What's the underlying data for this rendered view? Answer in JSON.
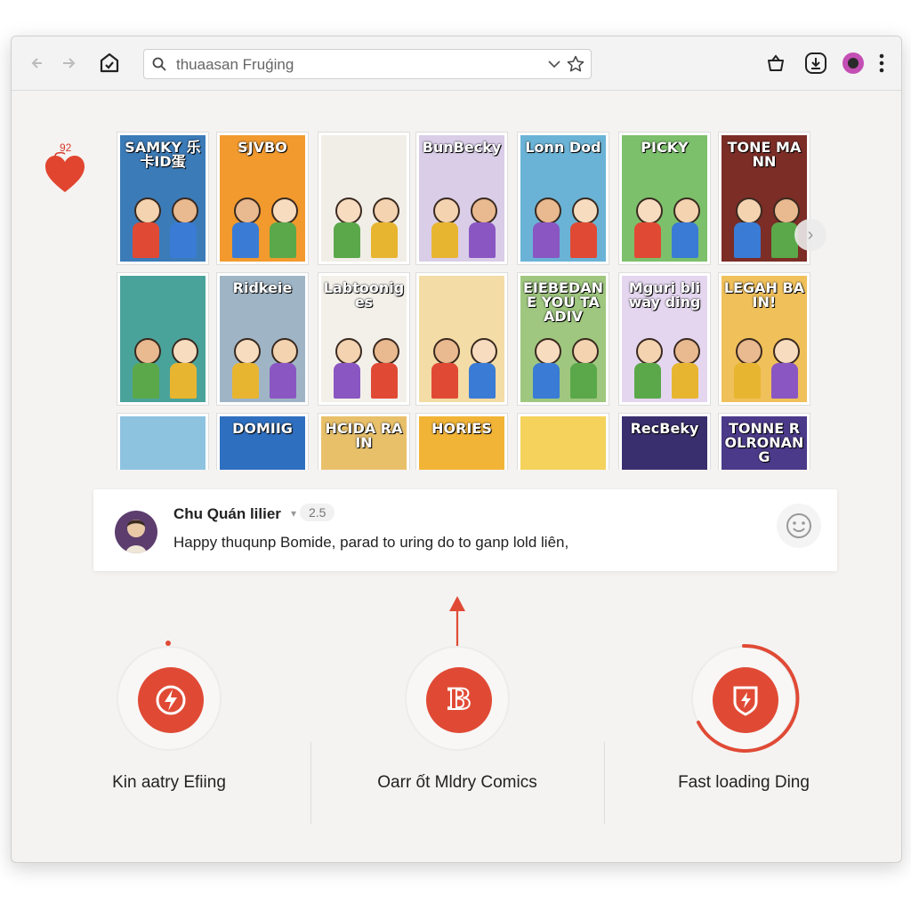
{
  "browser": {
    "back_icon": "arrow-left-icon",
    "forward_icon": "arrow-right-icon",
    "home_icon": "check-shield-icon",
    "search_text": "thuaasan Fruǵing",
    "toolbar_icons": [
      "basket-icon",
      "download-icon",
      "profile-icon",
      "more-icon"
    ]
  },
  "heart_badge": {
    "label": "92"
  },
  "comics": [
    {
      "title": "SAMKY 乐卡ID蛋",
      "bg": "#3b7bb8"
    },
    {
      "title": "SJVBO",
      "bg": "#f29a2e"
    },
    {
      "title": "",
      "bg": "#f1eee8"
    },
    {
      "title": "BunBecky",
      "bg": "#d9cde8"
    },
    {
      "title": "Lonn Dod",
      "bg": "#6ab3d6"
    },
    {
      "title": "PICKY",
      "bg": "#7cc06b"
    },
    {
      "title": "TONE MANN",
      "bg": "#7b2d26"
    },
    {
      "title": "",
      "bg": "#4aa39a"
    },
    {
      "title": "Ridkeie",
      "bg": "#9fb5c6"
    },
    {
      "title": "Labtooniges",
      "bg": "#f3f0ea"
    },
    {
      "title": "",
      "bg": "#f3dca6"
    },
    {
      "title": "EIEBEDANE YOU TAADIV",
      "bg": "#9fc77f"
    },
    {
      "title": "Mguri bliway ding",
      "bg": "#e5d6f0"
    },
    {
      "title": "LEGAH BAIN!",
      "bg": "#f0c05a"
    },
    {
      "title": "",
      "bg": "#8ec3e0"
    },
    {
      "title": "DOMIIG",
      "bg": "#2f6fc0"
    },
    {
      "title": "HCIDA RAIN",
      "bg": "#e9c06a"
    },
    {
      "title": "HORIES",
      "bg": "#f2b436"
    },
    {
      "title": "",
      "bg": "#f4d25c"
    },
    {
      "title": "RecBeky",
      "bg": "#3a2f6e"
    },
    {
      "title": "TONNE ROLRONANG",
      "bg": "#4b3a8a"
    }
  ],
  "comment": {
    "author": "Chu Quán lilier",
    "rating": "2.5",
    "text": "Happy thuqunp Bomide, parad to uring do to ganp lold liên,"
  },
  "features": [
    {
      "label": "Kin aatry Efiing",
      "icon": "lightning-icon"
    },
    {
      "label": "Oarr ốt Mldry Comics",
      "icon": "b-logo-icon"
    },
    {
      "label": "Fast loading Ding",
      "icon": "shield-bolt-icon"
    }
  ],
  "colors": {
    "accent": "#e04a35"
  }
}
